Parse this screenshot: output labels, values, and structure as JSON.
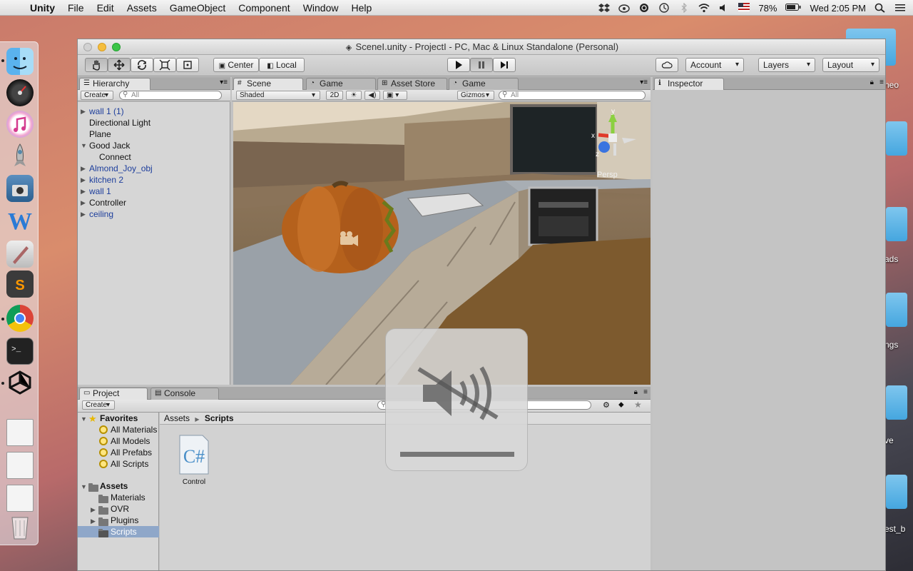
{
  "menubar": {
    "app_name": "Unity",
    "menus": [
      "File",
      "Edit",
      "Assets",
      "GameObject",
      "Component",
      "Window",
      "Help"
    ],
    "battery": "78%",
    "clock": "Wed 2:05 PM"
  },
  "window": {
    "title": "SceneI.unity - ProjectI - PC, Mac & Linux Standalone (Personal)"
  },
  "toolbar": {
    "pivot_label": "Center",
    "space_label": "Local",
    "account_label": "Account",
    "layers_label": "Layers",
    "layout_label": "Layout"
  },
  "hierarchy": {
    "tab_label": "Hierarchy",
    "create_label": "Create",
    "search_placeholder": "All",
    "items": [
      {
        "label": "wall 1 (1)",
        "expandable": true,
        "prefab": true
      },
      {
        "label": "Directional Light",
        "expandable": false,
        "prefab": false
      },
      {
        "label": "Plane",
        "expandable": false,
        "prefab": false
      },
      {
        "label": "Good Jack",
        "expandable": true,
        "expanded": true,
        "prefab": false
      },
      {
        "label": "Connect",
        "expandable": false,
        "prefab": false,
        "indent": 1
      },
      {
        "label": "Almond_Joy_obj",
        "expandable": true,
        "prefab": true
      },
      {
        "label": "kitchen 2",
        "expandable": true,
        "prefab": true
      },
      {
        "label": "wall 1",
        "expandable": true,
        "prefab": true
      },
      {
        "label": "Controller",
        "expandable": true,
        "prefab": false
      },
      {
        "label": "ceiling",
        "expandable": true,
        "prefab": true
      }
    ]
  },
  "scene_tabs": {
    "tabs": [
      "Scene",
      "Game",
      "Asset Store",
      "Game"
    ],
    "active_index": 0,
    "shading_mode": "Shaded",
    "mode_2d": "2D",
    "gizmos_label": "Gizmos",
    "search_placeholder": "All",
    "persp_label": "Persp",
    "gizmo_axes": {
      "y": "y",
      "x": "x",
      "z": "z"
    }
  },
  "inspector": {
    "tab_label": "Inspector"
  },
  "project": {
    "tabs": [
      "Project",
      "Console"
    ],
    "active_index": 0,
    "create_label": "Create",
    "favorites_label": "Favorites",
    "favorites": [
      "All Materials",
      "All Models",
      "All Prefabs",
      "All Scripts"
    ],
    "assets_label": "Assets",
    "folders": [
      {
        "label": "Materials",
        "expandable": false
      },
      {
        "label": "OVR",
        "expandable": true
      },
      {
        "label": "Plugins",
        "expandable": true
      },
      {
        "label": "Scripts",
        "expandable": false,
        "selected": true
      }
    ],
    "breadcrumb": [
      "Assets",
      "Scripts"
    ],
    "files": [
      {
        "label": "Control",
        "type": "C#"
      }
    ]
  },
  "desktop": {
    "labels": [
      "neo",
      "ads",
      "ngs",
      "ve",
      "est_b"
    ]
  },
  "colors": {
    "accent_blue": "#1d3e9c",
    "selection": "#8fa7c9",
    "unity_bg": "#c2c2c2"
  }
}
